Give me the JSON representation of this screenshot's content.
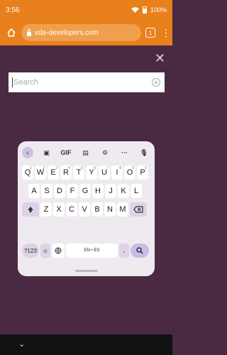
{
  "status": {
    "time": "3:56",
    "battery_label": "100%"
  },
  "browser": {
    "url": "xda-developers.com",
    "tab_count": "1"
  },
  "search": {
    "placeholder": "Search"
  },
  "keyboard": {
    "toolbar": [
      "GIF"
    ],
    "row1": [
      {
        "key": "Q",
        "hint": "1"
      },
      {
        "key": "W",
        "hint": "2"
      },
      {
        "key": "E",
        "hint": "3"
      },
      {
        "key": "R",
        "hint": "4"
      },
      {
        "key": "T",
        "hint": "5"
      },
      {
        "key": "Y",
        "hint": "6"
      },
      {
        "key": "U",
        "hint": "7"
      },
      {
        "key": "I",
        "hint": "8"
      },
      {
        "key": "O",
        "hint": "9"
      },
      {
        "key": "P",
        "hint": "0"
      }
    ],
    "row2": [
      "A",
      "S",
      "D",
      "F",
      "G",
      "H",
      "J",
      "K",
      "L"
    ],
    "row3": [
      "Z",
      "X",
      "C",
      "V",
      "B",
      "N",
      "M"
    ],
    "numbers_key": "?123",
    "emoji_key": "☺",
    "space_label": "EN • ES",
    "period_key": "."
  }
}
